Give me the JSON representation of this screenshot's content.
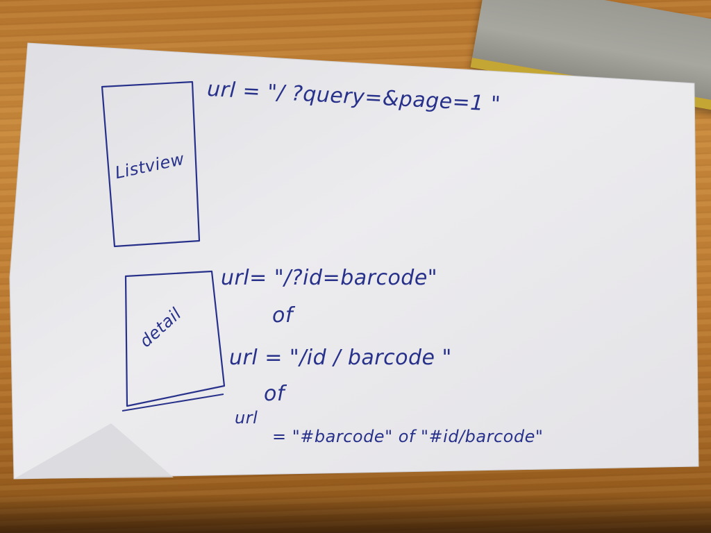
{
  "sketch": {
    "listview": {
      "box_label": "Listview",
      "url": "url = \"/ ?query=&page=1 \""
    },
    "detail": {
      "box_label": "detail",
      "url_1": "url= \"/?id=barcode\"",
      "or_1": "of",
      "url_2": "url = \"/id / barcode \"",
      "or_2": "of",
      "url_3_label": "url",
      "url_3": "= \"#barcode\"  of  \"#id/barcode\""
    }
  },
  "colors": {
    "ink": "#27318a",
    "paper": "#ecebee",
    "table_wood": "#c0802f"
  }
}
